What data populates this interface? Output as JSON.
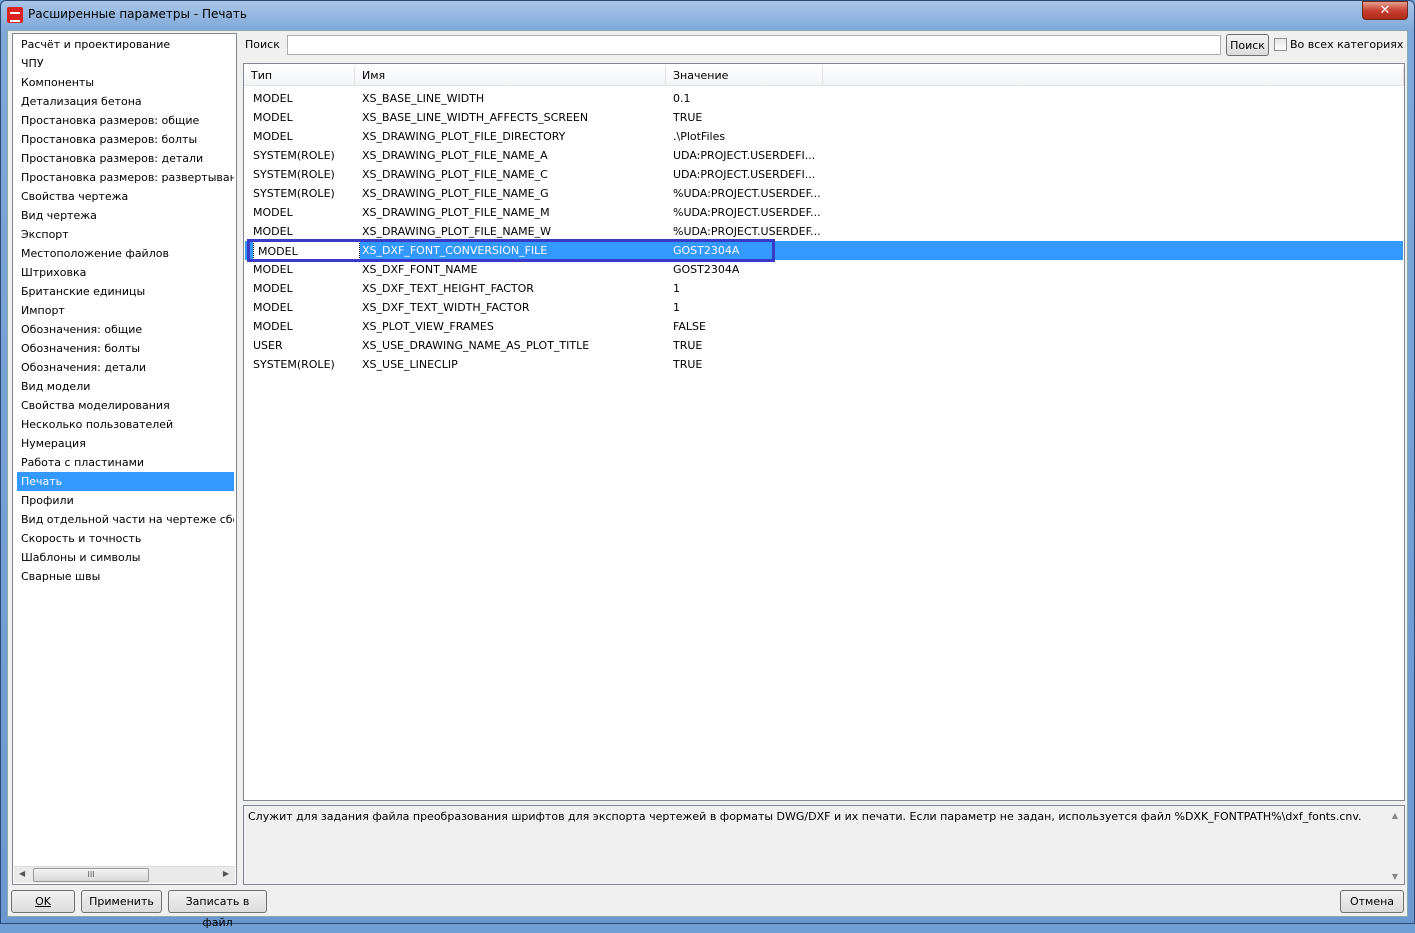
{
  "window": {
    "title": "Расширенные параметры - Печать",
    "close": "✕"
  },
  "categories": [
    "Расчёт и проектирование",
    "ЧПУ",
    "Компоненты",
    "Детализация бетона",
    "Простановка размеров: общие",
    "Простановка размеров: болты",
    "Простановка размеров: детали",
    "Простановка размеров: развертывание",
    "Свойства чертежа",
    "Вид чертежа",
    "Экспорт",
    "Местоположение файлов",
    "Штриховка",
    "Британские единицы",
    "Импорт",
    "Обозначения: общие",
    "Обозначения: болты",
    "Обозначения: детали",
    "Вид модели",
    "Свойства моделирования",
    "Несколько пользователей",
    "Нумерация",
    "Работа с пластинами",
    "Печать",
    "Профили",
    "Вид отдельной части на чертеже сборки",
    "Скорость и точность",
    "Шаблоны и символы",
    "Сварные швы"
  ],
  "selected_category": "Печать",
  "search": {
    "label": "Поиск",
    "value": "",
    "button": "Поиск",
    "all_categories_label": "Во всех категориях",
    "all_categories_checked": false
  },
  "table": {
    "headers": [
      "Тип",
      "Имя",
      "Значение"
    ],
    "selected_index": 8,
    "rows": [
      [
        "MODEL",
        "XS_BASE_LINE_WIDTH",
        "0.1"
      ],
      [
        "MODEL",
        "XS_BASE_LINE_WIDTH_AFFECTS_SCREEN",
        "TRUE"
      ],
      [
        "MODEL",
        "XS_DRAWING_PLOT_FILE_DIRECTORY",
        ".\\PlotFiles"
      ],
      [
        "SYSTEM(ROLE)",
        "XS_DRAWING_PLOT_FILE_NAME_A",
        "UDA:PROJECT.USERDEFI..."
      ],
      [
        "SYSTEM(ROLE)",
        "XS_DRAWING_PLOT_FILE_NAME_C",
        "UDA:PROJECT.USERDEFI..."
      ],
      [
        "SYSTEM(ROLE)",
        "XS_DRAWING_PLOT_FILE_NAME_G",
        "%UDA:PROJECT.USERDEF..."
      ],
      [
        "MODEL",
        "XS_DRAWING_PLOT_FILE_NAME_M",
        "%UDA:PROJECT.USERDEF..."
      ],
      [
        "MODEL",
        "XS_DRAWING_PLOT_FILE_NAME_W",
        "%UDA:PROJECT.USERDEF..."
      ],
      [
        "MODEL",
        "XS_DXF_FONT_CONVERSION_FILE",
        "GOST2304A"
      ],
      [
        "MODEL",
        "XS_DXF_FONT_NAME",
        "GOST2304A"
      ],
      [
        "MODEL",
        "XS_DXF_TEXT_HEIGHT_FACTOR",
        "1"
      ],
      [
        "MODEL",
        "XS_DXF_TEXT_WIDTH_FACTOR",
        "1"
      ],
      [
        "MODEL",
        "XS_PLOT_VIEW_FRAMES",
        "FALSE"
      ],
      [
        "USER",
        "XS_USE_DRAWING_NAME_AS_PLOT_TITLE",
        "TRUE"
      ],
      [
        "SYSTEM(ROLE)",
        "XS_USE_LINECLIP",
        "TRUE"
      ]
    ]
  },
  "description": "Служит для задания файла преобразования шрифтов для экспорта чертежей в форматы DWG/DXF и их печати. Если параметр не задан, используется файл %DXK_FONTPATH%\\dxf_fonts.cnv.",
  "buttons": {
    "ok": "OK",
    "apply": "Применить",
    "save": "Записать в файл",
    "cancel": "Отмена"
  },
  "colors": {
    "selection": "#3399ff",
    "focus": "#3a3ac8"
  }
}
